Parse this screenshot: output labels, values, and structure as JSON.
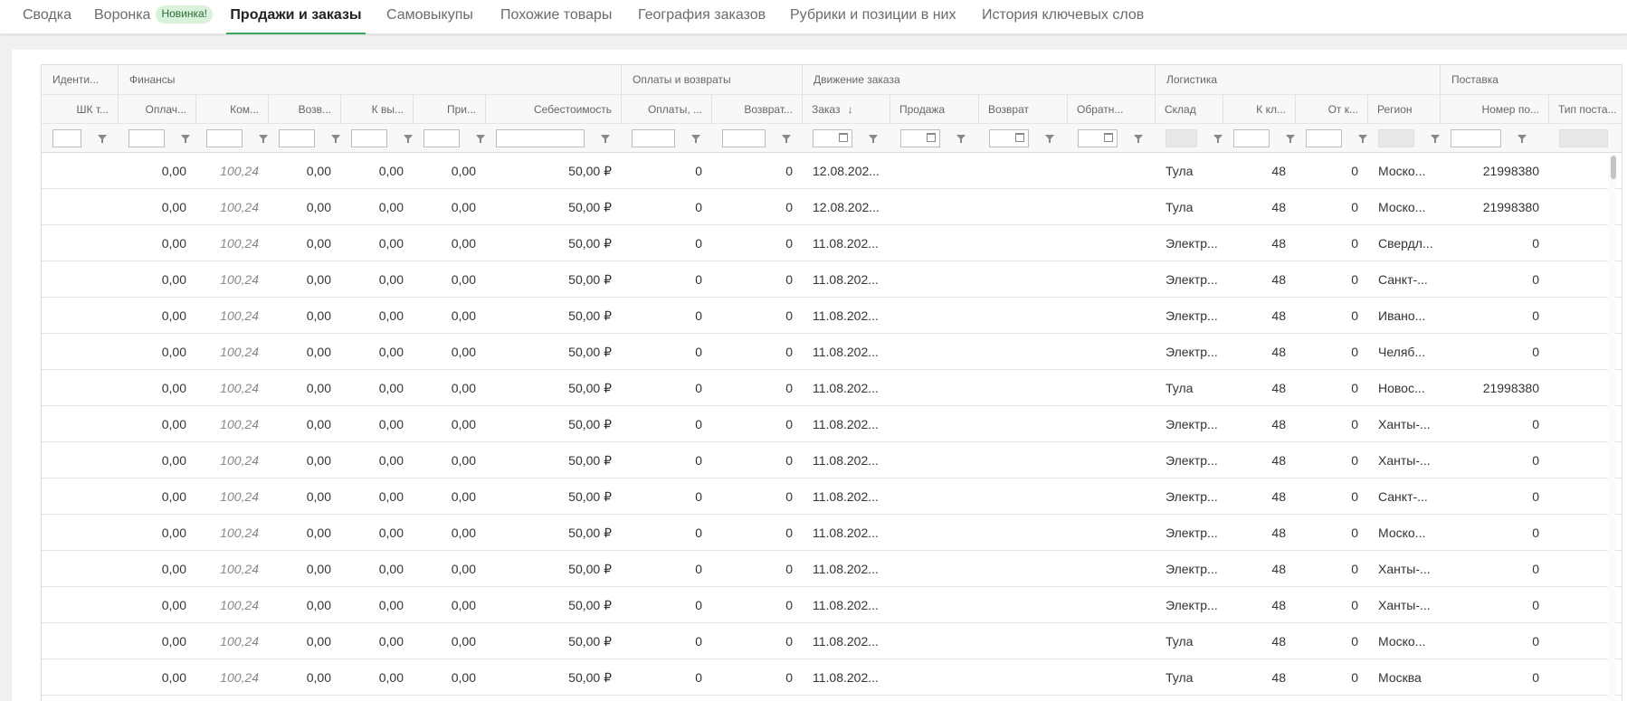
{
  "tabs": [
    {
      "label": "Сводка"
    },
    {
      "label": "Воронка",
      "badge": "Новинка!"
    },
    {
      "label": "Продажи и заказы",
      "active": true
    },
    {
      "label": "Самовыкупы"
    },
    {
      "label": "Похожие товары"
    },
    {
      "label": "География заказов"
    },
    {
      "label": "Рубрики и позиции в них"
    },
    {
      "label": "История ключевых слов"
    }
  ],
  "groups": [
    "Иденти...",
    "Финансы",
    "Оплаты и возвраты",
    "Движение заказа",
    "Логистика",
    "Поставка"
  ],
  "columns": [
    "ШК т...",
    "Оплач...",
    "Ком...",
    "Возв...",
    "К вы...",
    "При...",
    "Себестоимость",
    "Оплаты, ...",
    "Возврат...",
    "Заказ",
    "Продажа",
    "Возврат",
    "Обратн...",
    "Склад",
    "К кл...",
    "От к...",
    "Регион",
    "Номер по...",
    "Тип поста..."
  ],
  "sort_indicator": "↓",
  "rows": [
    [
      "",
      "0,00",
      "100,24",
      "0,00",
      "0,00",
      "0,00",
      "50,00 ₽",
      "0",
      "0",
      "12.08.202...",
      "",
      "",
      "",
      "Тула",
      "48",
      "0",
      "Моско...",
      "21998380",
      ""
    ],
    [
      "",
      "0,00",
      "100,24",
      "0,00",
      "0,00",
      "0,00",
      "50,00 ₽",
      "0",
      "0",
      "12.08.202...",
      "",
      "",
      "",
      "Тула",
      "48",
      "0",
      "Моско...",
      "21998380",
      ""
    ],
    [
      "",
      "0,00",
      "100,24",
      "0,00",
      "0,00",
      "0,00",
      "50,00 ₽",
      "0",
      "0",
      "11.08.202...",
      "",
      "",
      "",
      "Электр...",
      "48",
      "0",
      "Свердл...",
      "0",
      ""
    ],
    [
      "",
      "0,00",
      "100,24",
      "0,00",
      "0,00",
      "0,00",
      "50,00 ₽",
      "0",
      "0",
      "11.08.202...",
      "",
      "",
      "",
      "Электр...",
      "48",
      "0",
      "Санкт-...",
      "0",
      ""
    ],
    [
      "",
      "0,00",
      "100,24",
      "0,00",
      "0,00",
      "0,00",
      "50,00 ₽",
      "0",
      "0",
      "11.08.202...",
      "",
      "",
      "",
      "Электр...",
      "48",
      "0",
      "Ивано...",
      "0",
      ""
    ],
    [
      "",
      "0,00",
      "100,24",
      "0,00",
      "0,00",
      "0,00",
      "50,00 ₽",
      "0",
      "0",
      "11.08.202...",
      "",
      "",
      "",
      "Электр...",
      "48",
      "0",
      "Челяб...",
      "0",
      ""
    ],
    [
      "",
      "0,00",
      "100,24",
      "0,00",
      "0,00",
      "0,00",
      "50,00 ₽",
      "0",
      "0",
      "11.08.202...",
      "",
      "",
      "",
      "Тула",
      "48",
      "0",
      "Новос...",
      "21998380",
      ""
    ],
    [
      "",
      "0,00",
      "100,24",
      "0,00",
      "0,00",
      "0,00",
      "50,00 ₽",
      "0",
      "0",
      "11.08.202...",
      "",
      "",
      "",
      "Электр...",
      "48",
      "0",
      "Ханты-...",
      "0",
      ""
    ],
    [
      "",
      "0,00",
      "100,24",
      "0,00",
      "0,00",
      "0,00",
      "50,00 ₽",
      "0",
      "0",
      "11.08.202...",
      "",
      "",
      "",
      "Электр...",
      "48",
      "0",
      "Ханты-...",
      "0",
      ""
    ],
    [
      "",
      "0,00",
      "100,24",
      "0,00",
      "0,00",
      "0,00",
      "50,00 ₽",
      "0",
      "0",
      "11.08.202...",
      "",
      "",
      "",
      "Электр...",
      "48",
      "0",
      "Санкт-...",
      "0",
      ""
    ],
    [
      "",
      "0,00",
      "100,24",
      "0,00",
      "0,00",
      "0,00",
      "50,00 ₽",
      "0",
      "0",
      "11.08.202...",
      "",
      "",
      "",
      "Электр...",
      "48",
      "0",
      "Моско...",
      "0",
      ""
    ],
    [
      "",
      "0,00",
      "100,24",
      "0,00",
      "0,00",
      "0,00",
      "50,00 ₽",
      "0",
      "0",
      "11.08.202...",
      "",
      "",
      "",
      "Электр...",
      "48",
      "0",
      "Ханты-...",
      "0",
      ""
    ],
    [
      "",
      "0,00",
      "100,24",
      "0,00",
      "0,00",
      "0,00",
      "50,00 ₽",
      "0",
      "0",
      "11.08.202...",
      "",
      "",
      "",
      "Электр...",
      "48",
      "0",
      "Ханты-...",
      "0",
      ""
    ],
    [
      "",
      "0,00",
      "100,24",
      "0,00",
      "0,00",
      "0,00",
      "50,00 ₽",
      "0",
      "0",
      "11.08.202...",
      "",
      "",
      "",
      "Тула",
      "48",
      "0",
      "Моско...",
      "0",
      ""
    ],
    [
      "",
      "0,00",
      "100,24",
      "0,00",
      "0,00",
      "0,00",
      "50,00 ₽",
      "0",
      "0",
      "11.08.202...",
      "",
      "",
      "",
      "Тула",
      "48",
      "0",
      "Москва",
      "0",
      ""
    ]
  ],
  "colors": {
    "accent": "#3ba55c",
    "badge_bg": "#d8f2dc"
  }
}
